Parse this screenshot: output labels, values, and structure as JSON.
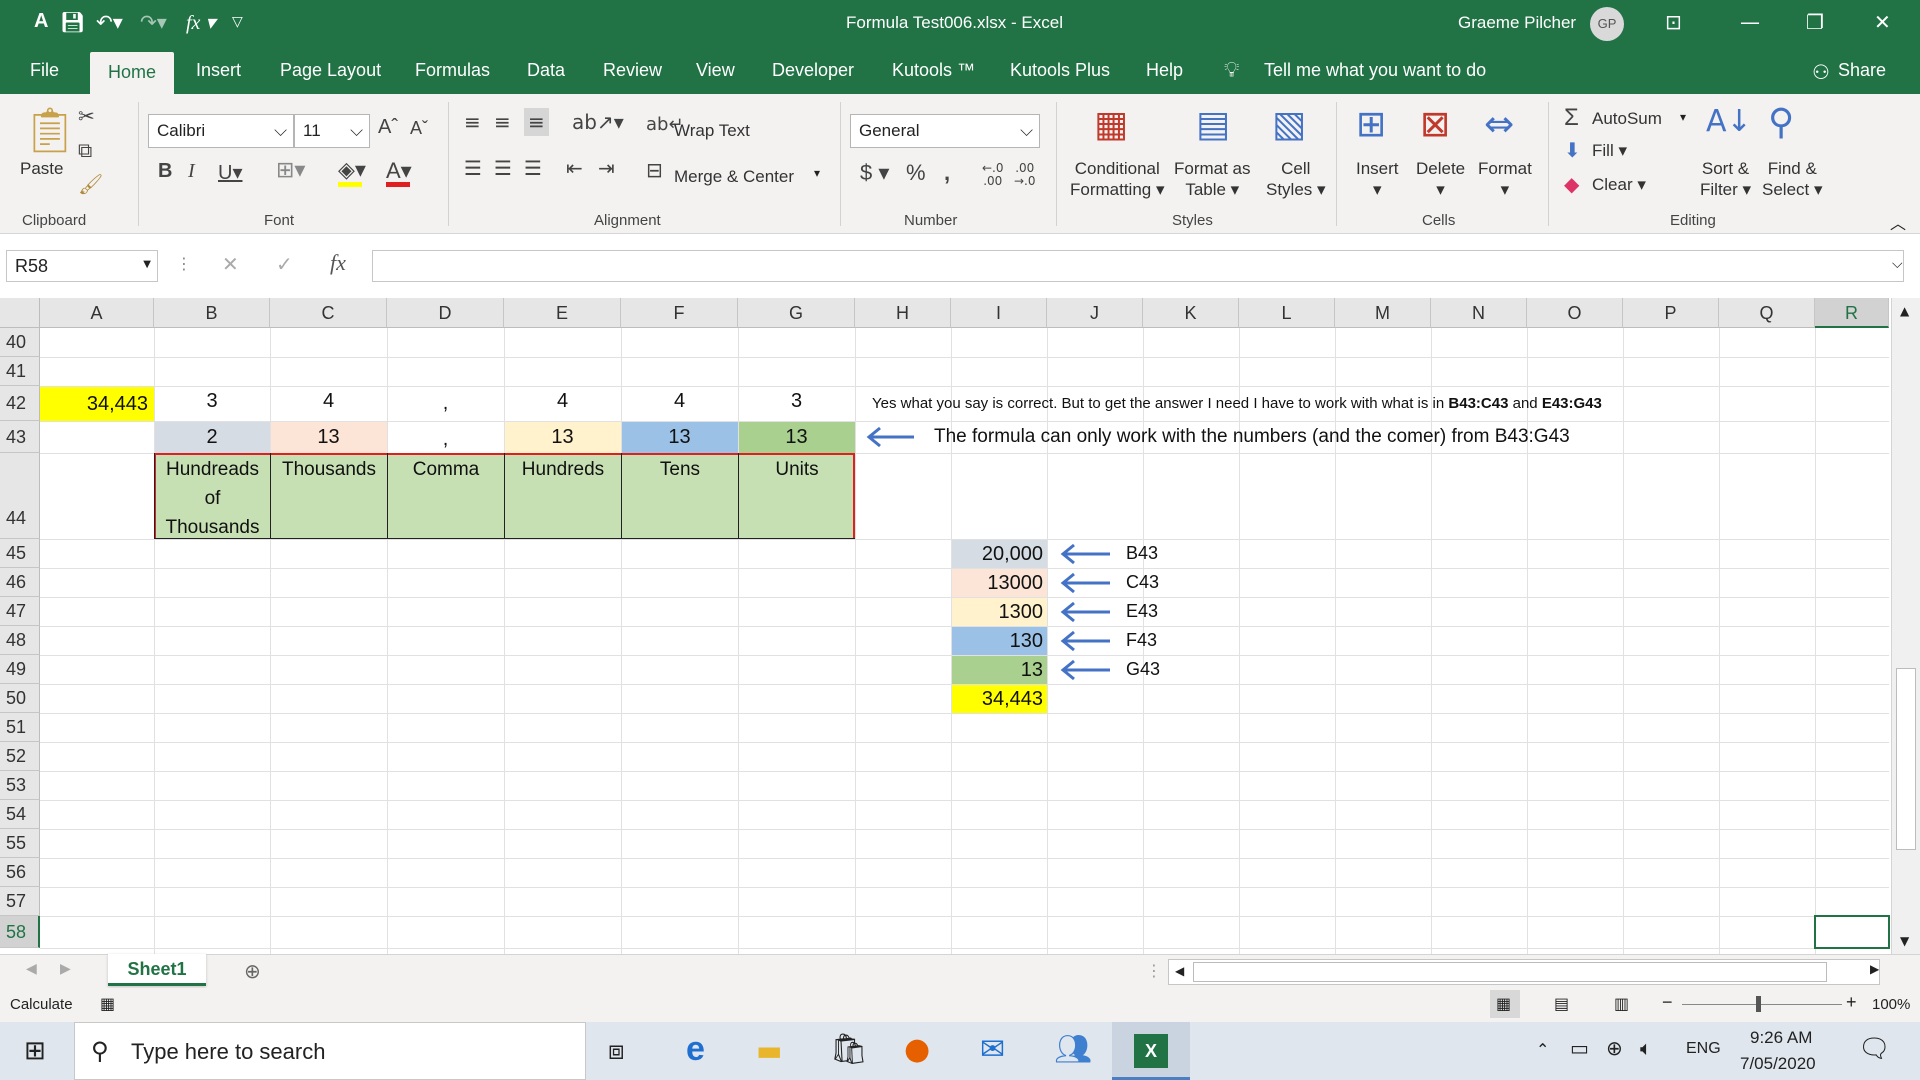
{
  "titlebar": {
    "title": "Formula Test006.xlsx  -  Excel",
    "user_name": "Graeme Pilcher",
    "user_initials": "GP"
  },
  "tabs": [
    "File",
    "Home",
    "Insert",
    "Page Layout",
    "Formulas",
    "Data",
    "Review",
    "View",
    "Developer",
    "Kutools ™",
    "Kutools Plus",
    "Help"
  ],
  "tell_me": "Tell me what you want to do",
  "share": "Share",
  "ribbon": {
    "clipboard": {
      "paste": "Paste",
      "group": "Clipboard"
    },
    "font": {
      "name": "Calibri",
      "size": "11",
      "group": "Font"
    },
    "alignment": {
      "wrap_text": "Wrap Text",
      "merge_center": "Merge & Center",
      "group": "Alignment"
    },
    "number": {
      "format": "General",
      "group": "Number"
    },
    "styles": {
      "conditional_1": "Conditional",
      "conditional_2": "Formatting",
      "format_as_1": "Format as",
      "format_as_2": "Table",
      "cell_styles_1": "Cell",
      "cell_styles_2": "Styles",
      "group": "Styles"
    },
    "cells": {
      "insert": "Insert",
      "delete": "Delete",
      "format": "Format",
      "group": "Cells"
    },
    "editing": {
      "autosum": "AutoSum",
      "fill": "Fill",
      "clear": "Clear",
      "sort_1": "Sort &",
      "sort_2": "Filter",
      "find_1": "Find &",
      "find_2": "Select",
      "group": "Editing"
    }
  },
  "formula_bar": {
    "name_box": "R58",
    "formula": ""
  },
  "columns": [
    "A",
    "B",
    "C",
    "D",
    "E",
    "F",
    "G",
    "H",
    "I",
    "J",
    "K",
    "L",
    "M",
    "N",
    "O",
    "P",
    "Q",
    "R"
  ],
  "rows": [
    "40",
    "41",
    "42",
    "43",
    "44",
    "45",
    "46",
    "47",
    "48",
    "49",
    "50",
    "51",
    "52",
    "53",
    "54",
    "55",
    "56",
    "57",
    "58"
  ],
  "cells": {
    "a42": "34,443",
    "r42": [
      "3",
      "4",
      ",",
      "4",
      "4",
      "3"
    ],
    "r43": [
      "2",
      "13",
      ",",
      "13",
      "13",
      "13"
    ],
    "r44": [
      "Hundreads of Thousands",
      "Thousands",
      "Comma",
      "Hundreds",
      "Tens",
      "Units"
    ],
    "h42_note": "Yes what you say is correct. But to get the answer I need I have to work with what is in ",
    "h42_ref1": "B43:C43",
    "h42_and": " and ",
    "h42_ref2": "E43:G43",
    "i43_note": "The formula can only work with the numbers (and the comer) from B43:G43",
    "i_values": [
      "20,000",
      "13000",
      "1300",
      "130",
      "13",
      "34,443"
    ],
    "j_refs": [
      "B43",
      "C43",
      "E43",
      "F43",
      "G43"
    ]
  },
  "colors": {
    "excel_green": "#217346",
    "yellow": "#ffff00",
    "b43": "#d6dce4",
    "c43": "#fce4d6",
    "e43": "#fff2cc",
    "f43": "#9bc2e6",
    "g43": "#a9d08e",
    "row44": "#c6e0b4",
    "arrow": "#4472c4",
    "border_red": "#e02020"
  },
  "sheet_tab": "Sheet1",
  "status": {
    "left": "Calculate",
    "zoom": "100%"
  },
  "taskbar": {
    "search": "Type here to search",
    "lang": "ENG",
    "time": "9:26 AM",
    "date": "7/05/2020"
  }
}
